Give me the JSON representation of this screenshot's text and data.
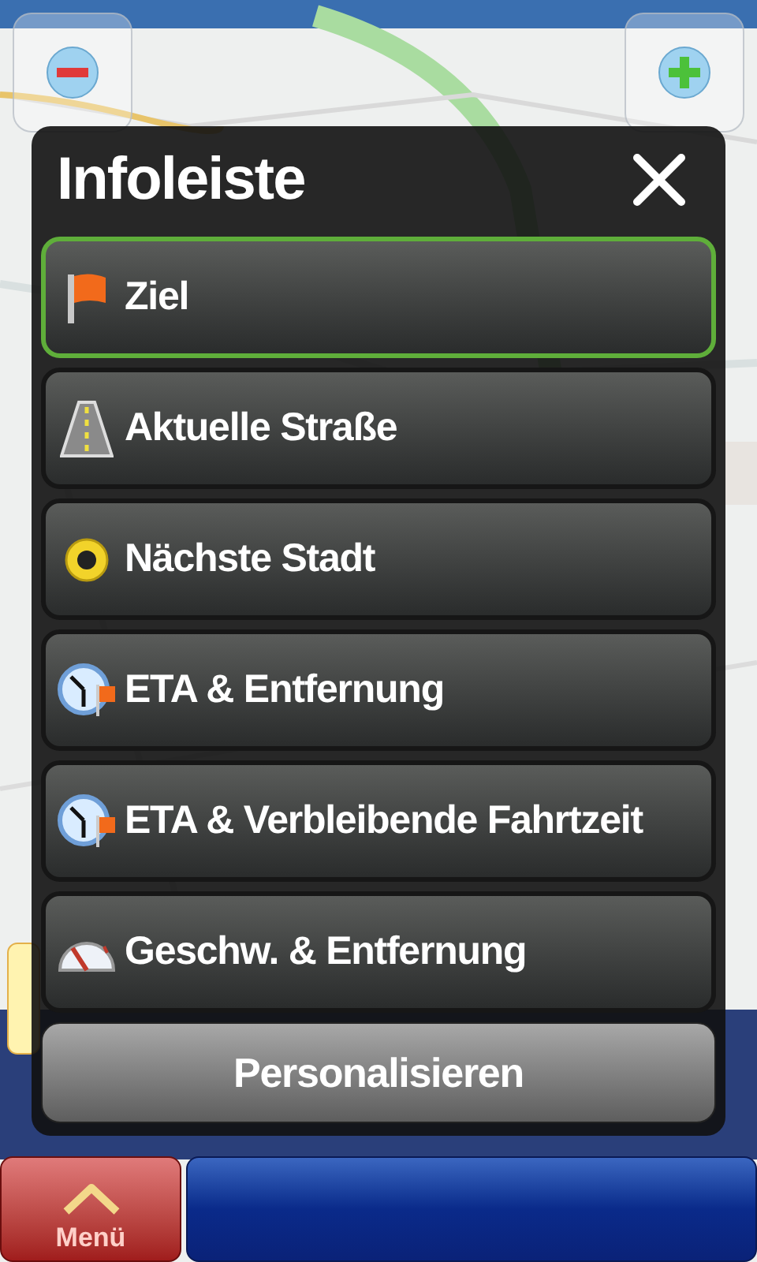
{
  "dialog": {
    "title": "Infoleiste",
    "items": [
      {
        "label": "Ziel",
        "kind": "flag",
        "selected": true
      },
      {
        "label": "Aktuelle Straße",
        "kind": "road",
        "selected": false
      },
      {
        "label": "Nächste Stadt",
        "kind": "city",
        "selected": false
      },
      {
        "label": "ETA & Entfernung",
        "kind": "eta",
        "selected": false
      },
      {
        "label": "ETA & Verbleibende Fahrtzeit",
        "kind": "eta",
        "selected": false
      },
      {
        "label": "Geschw. & Entfernung",
        "kind": "speed",
        "selected": false
      }
    ],
    "button": "Personalisieren"
  },
  "bottom_bar": {
    "menu_label": "Menü"
  }
}
